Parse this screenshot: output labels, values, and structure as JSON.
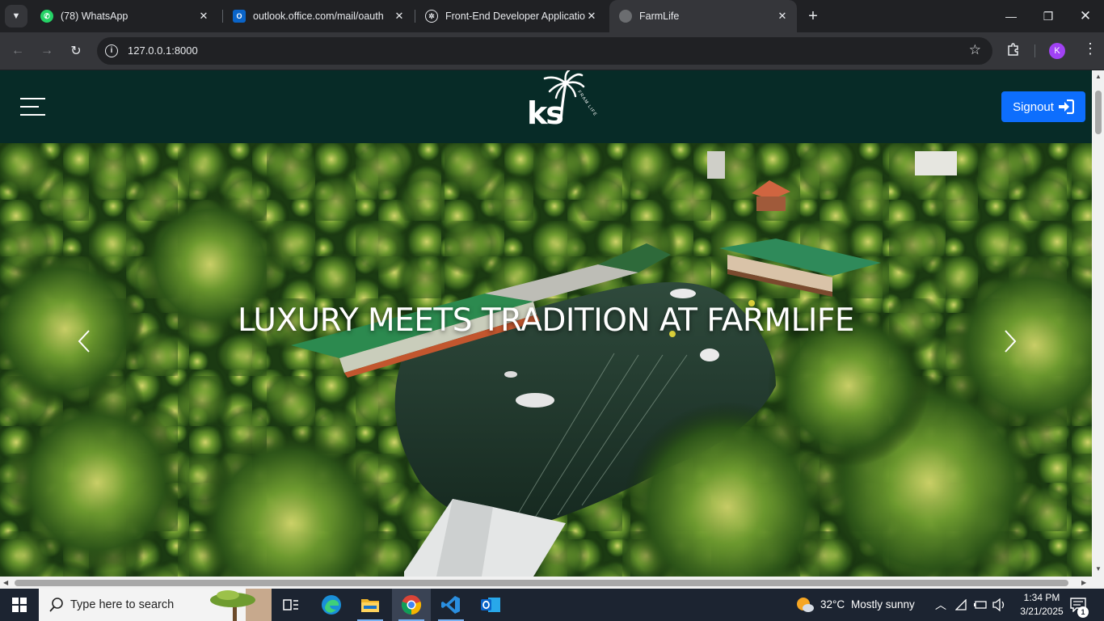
{
  "browser": {
    "tabs": [
      {
        "title": "(78) WhatsApp",
        "favicon": "whatsapp-icon"
      },
      {
        "title": "outlook.office.com/mail/oauth",
        "favicon": "outlook-icon"
      },
      {
        "title": "Front-End Developer Application",
        "favicon": "chatgpt-icon"
      },
      {
        "title": "FarmLife",
        "favicon": "globe-icon",
        "active": true
      }
    ],
    "url": "127.0.0.1:8000",
    "profile_initial": "K"
  },
  "site": {
    "logo_text": "ks",
    "logo_tagline": "FRAM LIFE",
    "signout_label": "Signout",
    "hero_title": "LUXURY MEETS TRADITION AT FARMLIFE"
  },
  "taskbar": {
    "search_placeholder": "Type here to search",
    "weather_temp": "32°C",
    "weather_desc": "Mostly sunny",
    "time": "1:34 PM",
    "date": "3/21/2025",
    "notification_count": "1"
  },
  "colors": {
    "site_header": "#072b27",
    "signout_button": "#0d6efd",
    "browser_frame": "#202124",
    "toolbar": "#35363a"
  }
}
